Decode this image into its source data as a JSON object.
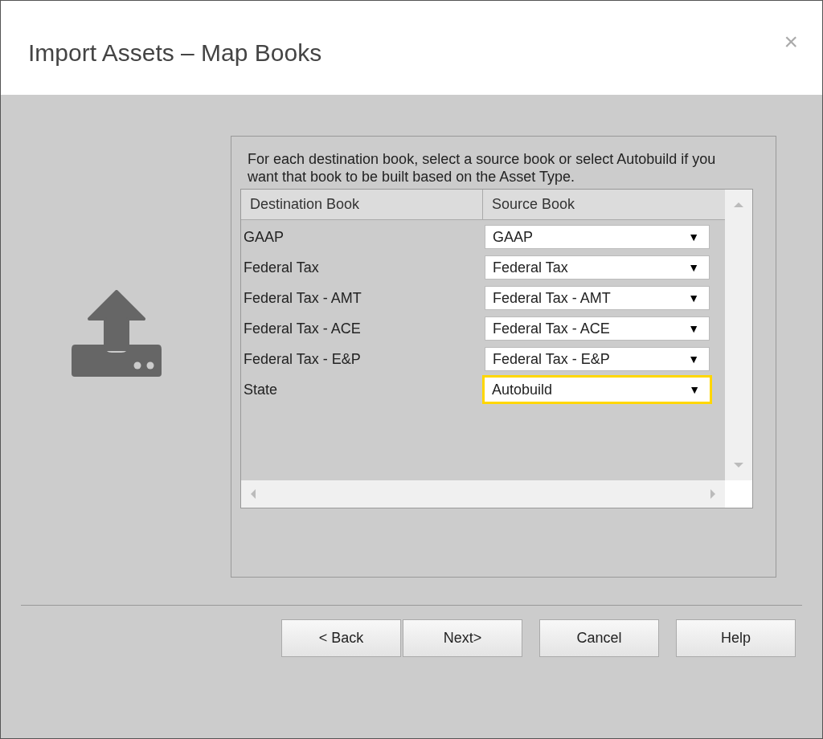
{
  "window": {
    "title": "Import Assets – Map Books",
    "close": "×"
  },
  "instructions": "For each destination book, select a source book or select Autobuild if you want that book to be built based on the Asset Type.",
  "table": {
    "columns": [
      "Destination Book",
      "Source Book"
    ],
    "rows": [
      {
        "destination": "GAAP",
        "source": "GAAP",
        "focused": false
      },
      {
        "destination": "Federal Tax",
        "source": "Federal Tax",
        "focused": false
      },
      {
        "destination": "Federal Tax - AMT",
        "source": "Federal Tax - AMT",
        "focused": false
      },
      {
        "destination": "Federal Tax - ACE",
        "source": "Federal Tax - ACE",
        "focused": false
      },
      {
        "destination": "Federal Tax - E&P",
        "source": "Federal Tax - E&P",
        "focused": false
      },
      {
        "destination": "State",
        "source": "Autobuild",
        "focused": true
      }
    ],
    "dropdown_arrow": "▼"
  },
  "buttons": [
    "< Back",
    "Next>",
    "Cancel",
    "Help"
  ]
}
